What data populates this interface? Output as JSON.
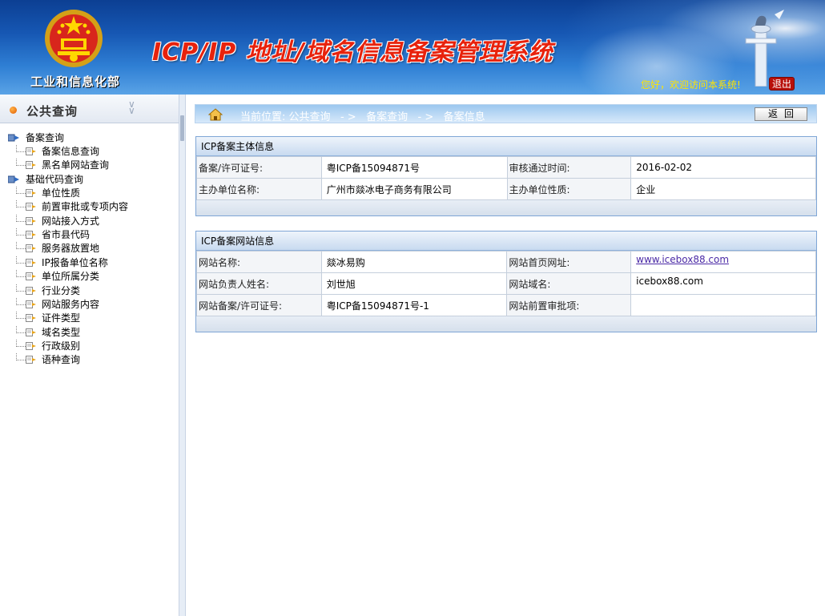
{
  "header": {
    "ministry": "工业和信息化部",
    "system_title": "ICP/IP 地址/域名信息备案管理系统",
    "welcome": "您好，欢迎访问本系统!",
    "logout_label": "退出"
  },
  "sidebar": {
    "title": "公共查询",
    "groups": [
      {
        "label": "备案查询",
        "items": [
          "备案信息查询",
          "黑名单网站查询"
        ]
      },
      {
        "label": "基础代码查询",
        "items": [
          "单位性质",
          "前置审批或专项内容",
          "网站接入方式",
          "省市县代码",
          "服务器放置地",
          "IP报备单位名称",
          "单位所属分类",
          "行业分类",
          "网站服务内容",
          "证件类型",
          "域名类型",
          "行政级别",
          "语种查询"
        ]
      }
    ]
  },
  "breadcrumb": {
    "prefix": "当前位置:",
    "parts": [
      "公共查询",
      "备案查询",
      "备案信息"
    ],
    "sep": "- >"
  },
  "back_label": "返回",
  "subject_panel": {
    "title": "ICP备案主体信息",
    "rows": [
      {
        "l1": "备案/许可证号:",
        "v1": "粤ICP备15094871号",
        "l2": "审核通过时间:",
        "v2": "2016-02-02"
      },
      {
        "l1": "主办单位名称:",
        "v1": "广州市燚冰电子商务有限公司",
        "l2": "主办单位性质:",
        "v2": "企业"
      }
    ]
  },
  "site_panel": {
    "title": "ICP备案网站信息",
    "rows": [
      {
        "l1": "网站名称:",
        "v1": "燚冰易购",
        "l2": "网站首页网址:",
        "v2": "www.icebox88.com"
      },
      {
        "l1": "网站负责人姓名:",
        "v1": "刘世旭",
        "l2": "网站域名:",
        "v2": "icebox88.com"
      },
      {
        "l1": "网站备案/许可证号:",
        "v1": "粤ICP备15094871号-1",
        "l2": "网站前置审批项:",
        "v2": ""
      }
    ]
  },
  "colors": {
    "accent": "#1657b3",
    "title_red": "#e8220c",
    "link": "#4b2aa6"
  }
}
